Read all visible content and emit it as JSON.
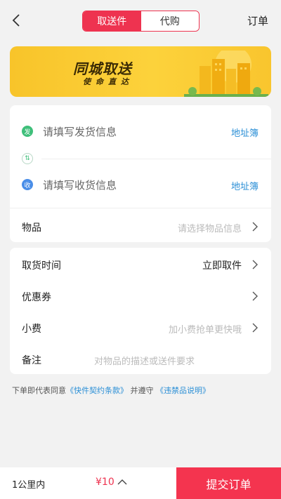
{
  "header": {
    "tabs": [
      {
        "label": "取送件",
        "active": true
      },
      {
        "label": "代购",
        "active": false
      }
    ],
    "orders_label": "订单"
  },
  "banner": {
    "title": "同城取送",
    "subtitle": "使命直达"
  },
  "address": {
    "sender": {
      "badge": "发",
      "placeholder": "请填写发货信息",
      "book_label": "地址簿"
    },
    "swap_icon": "⇅",
    "receiver": {
      "badge": "收",
      "placeholder": "请填写收货信息",
      "book_label": "地址簿"
    }
  },
  "item": {
    "label": "物品",
    "placeholder": "请选择物品信息"
  },
  "options": {
    "pickup_time": {
      "label": "取货时间",
      "value": "立即取件"
    },
    "coupon": {
      "label": "优惠券"
    },
    "tip": {
      "label": "小费",
      "placeholder": "加小费抢单更快哦"
    },
    "remark": {
      "label": "备注",
      "placeholder": "对物品的描述或送件要求"
    }
  },
  "agreement": {
    "prefix": "下单即代表同意",
    "link1": "《快件契约条款》",
    "middle": "并遵守",
    "link2": "《违禁品说明》"
  },
  "footer": {
    "distance": "1公里内",
    "price": "¥10",
    "submit_label": "提交订单"
  },
  "colors": {
    "accent": "#ee3350",
    "link": "#2b8fd6",
    "banner": "#fcd23b",
    "send_badge": "#3fbf7a",
    "recv_badge": "#4a8ee8"
  },
  "icons": {
    "back": "back-arrow-icon",
    "chevron": "chevron-right-icon",
    "caret": "caret-up-icon"
  }
}
